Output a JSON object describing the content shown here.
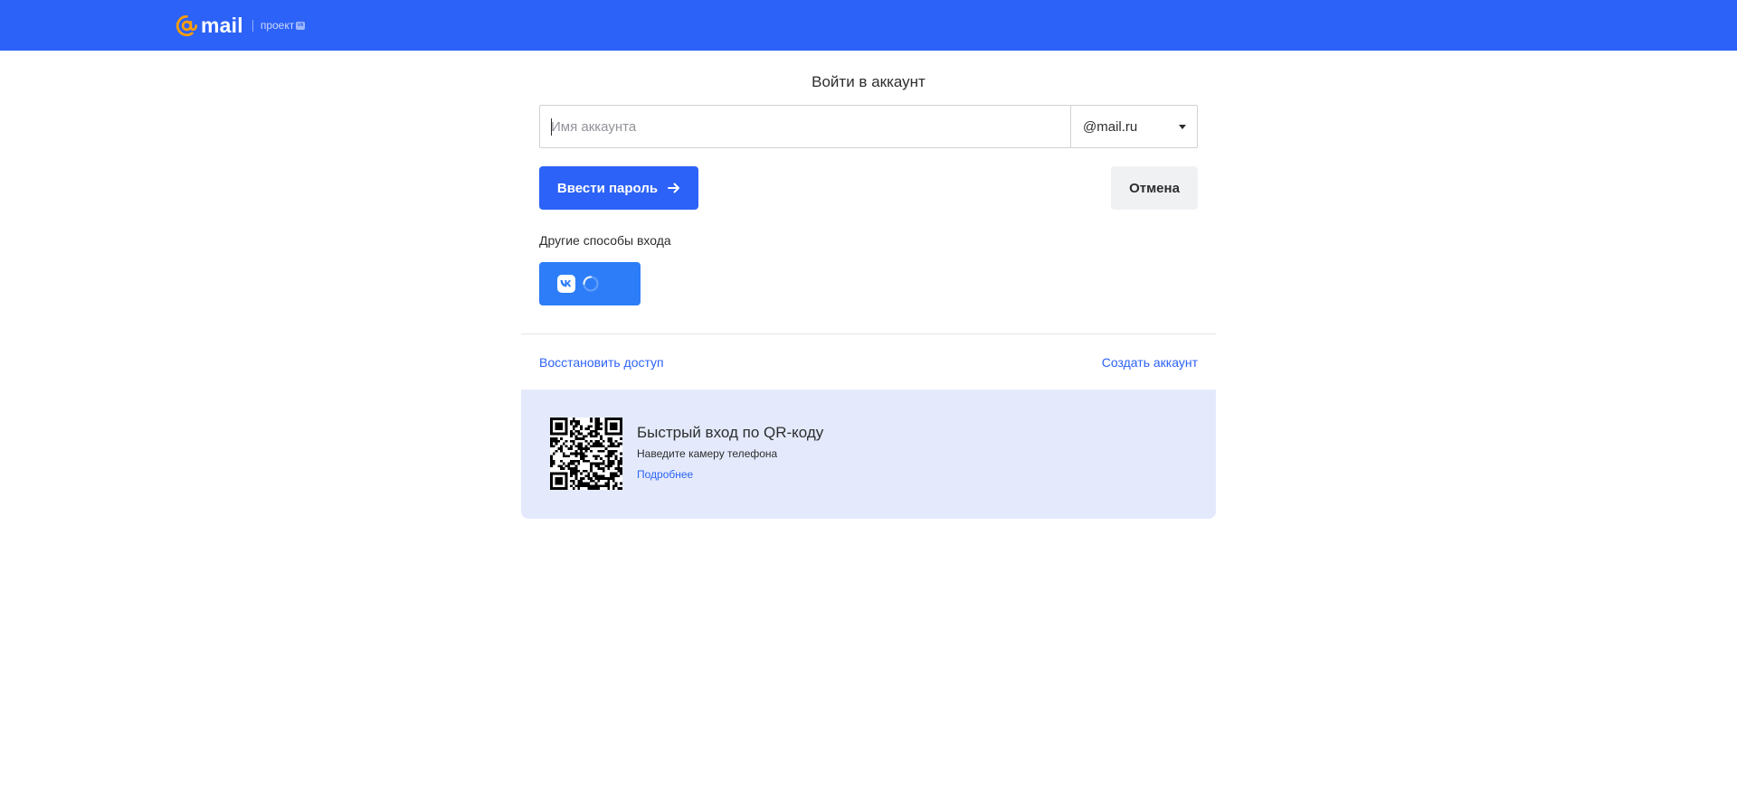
{
  "header": {
    "logo_text": "mail",
    "project_text": "проект",
    "brand_color": "#2c62f7",
    "logo_accent": "#ff9e00"
  },
  "login": {
    "title": "Войти в аккаунт",
    "account_placeholder": "Имя аккаунта",
    "account_value": "",
    "domain_selected": "@mail.ru",
    "submit_label": "Ввести пароль",
    "cancel_label": "Отмена",
    "other_methods_label": "Другие способы входа",
    "vk_button_icon": "vk-icon",
    "vk_button_state_icon": "spinner-icon"
  },
  "footer_links": {
    "restore": "Восстановить доступ",
    "create": "Создать аккаунт"
  },
  "qr": {
    "title": "Быстрый вход по QR-коду",
    "subtitle": "Наведите камеру телефона",
    "more_link": "Подробнее"
  }
}
